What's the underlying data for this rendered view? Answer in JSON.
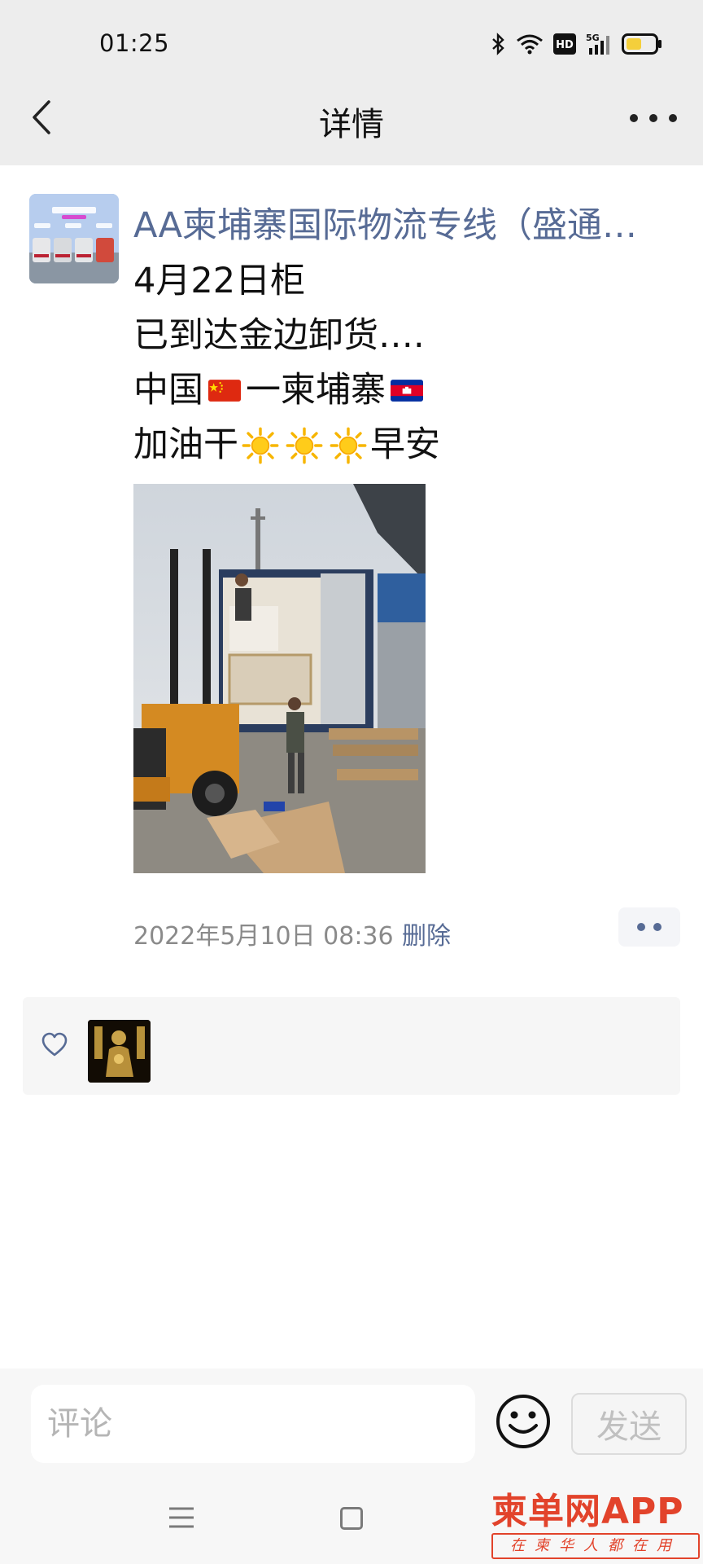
{
  "status_bar": {
    "time": "01:25",
    "icons": [
      "bluetooth-icon",
      "wifi-icon",
      "hd-icon",
      "signal-5g-icon",
      "battery-icon"
    ],
    "hd_label": "HD",
    "network_label": "5G"
  },
  "header": {
    "title": "详情",
    "back_icon": "chevron-left-icon",
    "more_icon": "more-dots-icon"
  },
  "post": {
    "author": "AA柬埔寨国际物流专线（盛通…",
    "lines": {
      "l1": "4月22日柜",
      "l2": "已到达金边卸货….",
      "l3_a": "中国",
      "l3_b": " 一柬埔寨",
      "l4_a": "加油干",
      "l4_b": "早安"
    },
    "emoji": [
      "china-flag-icon",
      "cambodia-flag-icon",
      "sun-icon",
      "sun-icon",
      "sun-icon"
    ],
    "timestamp": "2022年5月10日 08:36",
    "delete_label": "删除"
  },
  "likes": {
    "heart_icon": "heart-outline-icon"
  },
  "comment_bar": {
    "placeholder": "评论",
    "send_label": "发送",
    "emoji_icon": "smiley-icon"
  },
  "watermark": {
    "main": "柬单网APP",
    "sub": "在柬华人都在用"
  },
  "colors": {
    "link": "#576b95",
    "header_bg": "#ededed",
    "watermark": "#e2432b"
  }
}
